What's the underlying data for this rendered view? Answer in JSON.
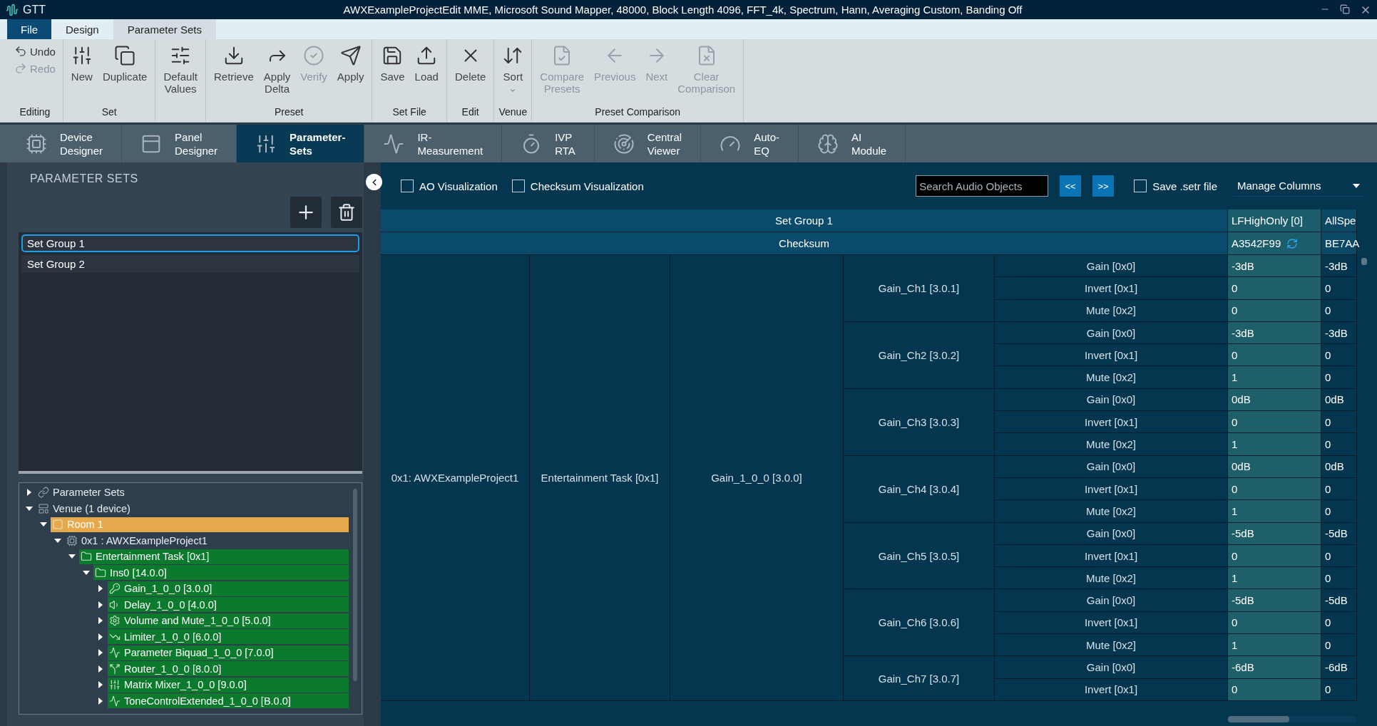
{
  "title_bar": {
    "app": "GTT",
    "title": "AWXExampleProjectEdit MME, Microsoft Sound Mapper, 48000, Block Length 4096, FFT_4k, Spectrum, Hann, Averaging Custom, Banding Off"
  },
  "ribbon": {
    "file_button": "File",
    "tabs": [
      {
        "label": "Design",
        "selected": false
      },
      {
        "label": "Parameter Sets",
        "selected": true
      }
    ],
    "groups": [
      {
        "label": "Editing",
        "items": [
          {
            "label": "Undo",
            "kind": "small",
            "disabled": false
          },
          {
            "label": "Redo",
            "kind": "small",
            "disabled": true
          }
        ]
      },
      {
        "label": "Set",
        "items": [
          {
            "label": "New",
            "kind": "large",
            "disabled": false
          },
          {
            "label": "Duplicate",
            "kind": "large",
            "disabled": false
          }
        ]
      },
      {
        "items": [
          {
            "label": "Default\nValues",
            "kind": "large",
            "disabled": false
          }
        ]
      },
      {
        "label": "Preset",
        "items": [
          {
            "label": "Retrieve",
            "kind": "large",
            "disabled": false
          },
          {
            "label": "Apply\nDelta",
            "kind": "large",
            "disabled": false
          },
          {
            "label": "Verify",
            "kind": "large",
            "disabled": true
          },
          {
            "label": "Apply",
            "kind": "large",
            "disabled": false
          }
        ]
      },
      {
        "label": "Set File",
        "items": [
          {
            "label": "Save",
            "kind": "large",
            "disabled": false
          },
          {
            "label": "Load",
            "kind": "large",
            "disabled": false
          }
        ]
      },
      {
        "label": "Edit",
        "items": [
          {
            "label": "Delete",
            "kind": "large",
            "disabled": false
          }
        ]
      },
      {
        "label": "Venue",
        "items": [
          {
            "label": "Sort",
            "kind": "menu",
            "disabled": false
          }
        ]
      },
      {
        "label": "Preset Comparison",
        "items": [
          {
            "label": "Compare\nPresets",
            "kind": "large",
            "disabled": true
          },
          {
            "label": "Previous",
            "kind": "large",
            "disabled": true
          },
          {
            "label": "Next",
            "kind": "large",
            "disabled": true
          },
          {
            "label": "Clear\nComparison",
            "kind": "large",
            "disabled": true
          }
        ]
      }
    ]
  },
  "nav_tabs": [
    {
      "label": "Device\nDesigner",
      "selected": false
    },
    {
      "label": "Panel\nDesigner",
      "selected": false
    },
    {
      "label": "Parameter-\nSets",
      "selected": true
    },
    {
      "label": "IR-\nMeasurement",
      "selected": false
    },
    {
      "label": "IVP\nRTA",
      "selected": false
    },
    {
      "label": "Central\nViewer",
      "selected": false
    },
    {
      "label": "Auto-\nEQ",
      "selected": false
    },
    {
      "label": "AI\nModule",
      "selected": false
    }
  ],
  "left_panel": {
    "title": "PARAMETER SETS",
    "set_groups": [
      {
        "label": "Set Group 1",
        "selected": true
      },
      {
        "label": "Set Group 2",
        "selected": false
      }
    ],
    "tree": [
      {
        "label": "Parameter Sets",
        "expanded": false
      },
      {
        "label": "Venue (1 device)",
        "expanded": true,
        "children": [
          {
            "label": "Room 1",
            "expanded": true,
            "color": "#e8a84c",
            "children": [
              {
                "label": "0x1 : AWXExampleProject1",
                "expanded": true,
                "children": [
                  {
                    "label": "Entertainment Task [0x1]",
                    "expanded": true,
                    "color": "#0b7a2c",
                    "children": [
                      {
                        "label": "Ins0 [14.0.0]",
                        "expanded": true,
                        "color": "#0b7a2c",
                        "children": [
                          {
                            "label": "Gain_1_0_0 [3.0.0]",
                            "expanded": false,
                            "color": "#0b7a2c"
                          },
                          {
                            "label": "Delay_1_0_0 [4.0.0]",
                            "expanded": false,
                            "color": "#0b7a2c"
                          },
                          {
                            "label": "Volume and Mute_1_0_0 [5.0.0]",
                            "expanded": false,
                            "color": "#0b7a2c"
                          },
                          {
                            "label": "Limiter_1_0_0 [6.0.0]",
                            "expanded": false,
                            "color": "#0b7a2c"
                          },
                          {
                            "label": "Parameter Biquad_1_0_0 [7.0.0]",
                            "expanded": false,
                            "color": "#0b7a2c"
                          },
                          {
                            "label": "Router_1_0_0 [8.0.0]",
                            "expanded": false,
                            "color": "#0b7a2c"
                          },
                          {
                            "label": "Matrix Mixer_1_0_0 [9.0.0]",
                            "expanded": false,
                            "color": "#0b7a2c"
                          },
                          {
                            "label": "ToneControlExtended_1_0_0 [B.0.0]",
                            "expanded": false,
                            "color": "#0b7a2c"
                          }
                        ]
                      }
                    ]
                  }
                ]
              }
            ]
          }
        ]
      }
    ]
  },
  "toolbar": {
    "checkboxes": [
      {
        "label": "AO Visualization",
        "checked": false
      },
      {
        "label": "Checksum Visualization",
        "checked": false
      }
    ],
    "search": {
      "placeholder": "Search Audio Objects"
    },
    "prev_button": "<<",
    "next_button": ">>",
    "save_checkbox": {
      "label": "Save .setr file",
      "checked": false
    },
    "columns_dropdown": "Manage Columns"
  },
  "table": {
    "set_group": "Set Group 1",
    "checksum_label": "Checksum",
    "presets": [
      {
        "name": "LFHighOnly [0]",
        "checksum": "A3542F99",
        "selected": true
      },
      {
        "name": "AllSpe",
        "checksum": "BE7AA",
        "selected": false
      }
    ],
    "device": "0x1: AWXExampleProject1",
    "task": "Entertainment Task [0x1]",
    "object": "Gain_1_0_0 [3.0.0]",
    "channels": [
      {
        "name": "Gain_Ch1 [3.0.1]",
        "params": [
          {
            "name": "Gain [0x0]",
            "values": [
              "-3dB",
              "-3dB"
            ]
          },
          {
            "name": "Invert [0x1]",
            "values": [
              "0",
              "0"
            ]
          },
          {
            "name": "Mute [0x2]",
            "values": [
              "0",
              "0"
            ]
          }
        ]
      },
      {
        "name": "Gain_Ch2 [3.0.2]",
        "params": [
          {
            "name": "Gain [0x0]",
            "values": [
              "-3dB",
              "-3dB"
            ]
          },
          {
            "name": "Invert [0x1]",
            "values": [
              "0",
              "0"
            ]
          },
          {
            "name": "Mute [0x2]",
            "values": [
              "1",
              "0"
            ]
          }
        ]
      },
      {
        "name": "Gain_Ch3 [3.0.3]",
        "params": [
          {
            "name": "Gain [0x0]",
            "values": [
              "0dB",
              "0dB"
            ]
          },
          {
            "name": "Invert [0x1]",
            "values": [
              "0",
              "0"
            ]
          },
          {
            "name": "Mute [0x2]",
            "values": [
              "1",
              "0"
            ]
          }
        ]
      },
      {
        "name": "Gain_Ch4 [3.0.4]",
        "params": [
          {
            "name": "Gain [0x0]",
            "values": [
              "0dB",
              "0dB"
            ]
          },
          {
            "name": "Invert [0x1]",
            "values": [
              "0",
              "0"
            ]
          },
          {
            "name": "Mute [0x2]",
            "values": [
              "1",
              "0"
            ]
          }
        ]
      },
      {
        "name": "Gain_Ch5 [3.0.5]",
        "params": [
          {
            "name": "Gain [0x0]",
            "values": [
              "-5dB",
              "-5dB"
            ]
          },
          {
            "name": "Invert [0x1]",
            "values": [
              "0",
              "0"
            ]
          },
          {
            "name": "Mute [0x2]",
            "values": [
              "1",
              "0"
            ]
          }
        ]
      },
      {
        "name": "Gain_Ch6 [3.0.6]",
        "params": [
          {
            "name": "Gain [0x0]",
            "values": [
              "-5dB",
              "-5dB"
            ]
          },
          {
            "name": "Invert [0x1]",
            "values": [
              "0",
              "0"
            ]
          },
          {
            "name": "Mute [0x2]",
            "values": [
              "1",
              "0"
            ]
          }
        ]
      },
      {
        "name": "Gain_Ch7 [3.0.7]",
        "params": [
          {
            "name": "Gain [0x0]",
            "values": [
              "-6dB",
              "-6dB"
            ]
          },
          {
            "name": "Invert [0x1]",
            "values": [
              "0",
              "0"
            ]
          }
        ]
      }
    ]
  }
}
